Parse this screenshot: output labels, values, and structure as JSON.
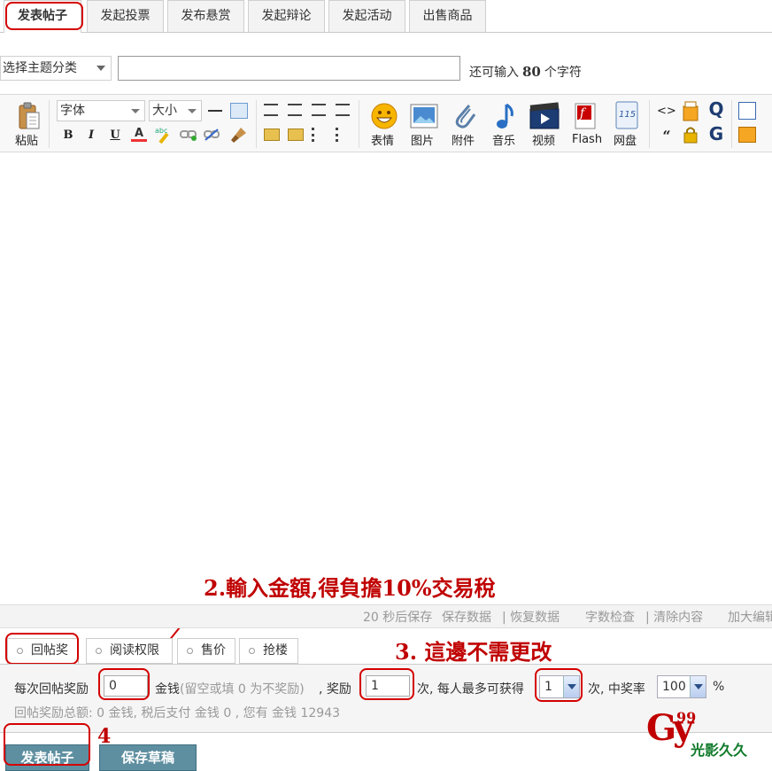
{
  "tabs": [
    {
      "label": "发表帖子",
      "active": true
    },
    {
      "label": "发起投票"
    },
    {
      "label": "发布悬赏"
    },
    {
      "label": "发起辩论"
    },
    {
      "label": "发起活动"
    },
    {
      "label": "出售商品"
    }
  ],
  "subject": {
    "category_label": "选择主题分类",
    "input_value": "",
    "hint_prefix": "还可输入",
    "hint_count": "80",
    "hint_suffix": "个字符"
  },
  "toolbar": {
    "paste": "粘贴",
    "font": "字体",
    "size": "大小",
    "bold": "B",
    "italic": "I",
    "underline": "U",
    "fontcolor": "A",
    "emoticon": "表情",
    "image": "图片",
    "attachment": "附件",
    "music": "音乐",
    "video": "视频",
    "flash": "Flash",
    "netdisk": "网盘"
  },
  "status": {
    "autosave": "20 秒后保存",
    "save_data": "保存数据",
    "restore_data": "| 恢复数据",
    "wordcount": "字数检查",
    "clear": "| 清除内容",
    "enlarge": "加大编辑"
  },
  "extra_tabs": [
    "回帖奖励",
    "阅读权限",
    "售价",
    "抢楼"
  ],
  "reward": {
    "label": "每次回帖奖励",
    "amount": "0",
    "currency": "金钱",
    "note": "(留空或填  0 为不奖励)",
    "reward_times_label": ", 奖励",
    "times": "1",
    "times_unit": "次, 每人最多可获得",
    "max_per_user": "1",
    "max_unit": "次, 中奖率",
    "rate": "100",
    "rate_unit": "%",
    "total_line": "回帖奖励总额: 0 金钱, 税后支付  金钱  0 , 您有  金钱  12943"
  },
  "buttons": {
    "post": "发表帖子",
    "draft": "保存草稿"
  },
  "annotations": {
    "step2": "2.輸入金額,得負擔10%交易稅",
    "step3": "3. 這邊不需更改",
    "step4": "4"
  },
  "watermark": {
    "letters": "Gy",
    "number": "99",
    "text": "光影久久"
  },
  "colors": {
    "annotation": "#d40000",
    "button": "#5e8fa0"
  }
}
